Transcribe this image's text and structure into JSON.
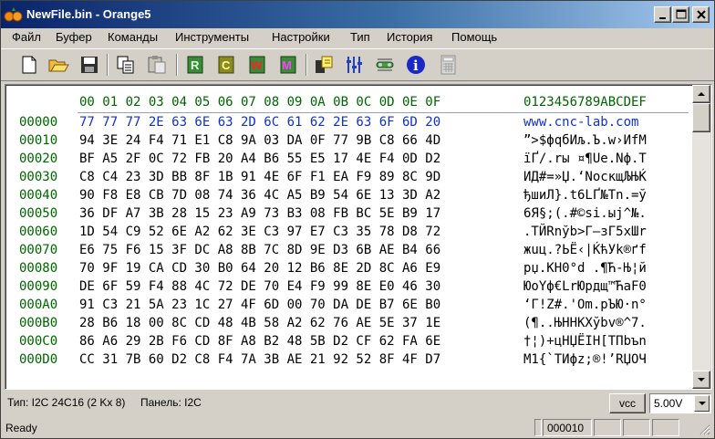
{
  "window": {
    "title": "NewFile.bin - Orange5"
  },
  "menu": [
    "Файл",
    "Буфер",
    "Команды",
    "Инструменты",
    "Настройки",
    "Тип",
    "История",
    "Помощь"
  ],
  "toolbar": {
    "read_label": "R",
    "compare_label": "C",
    "write_label": "W",
    "mode_label": "M",
    "info_label": "i",
    "colors": {
      "read": "#2a8a2a",
      "compare": "#8a8a10",
      "write": "#d01010",
      "mode": "#d010d0",
      "info": "#1010d0"
    }
  },
  "editor": {
    "header_hex": "00 01 02 03 04 05 06 07 08 09 0A 0B 0C 0D 0E 0F",
    "header_ascii": "0123456789ABCDEF",
    "rows": [
      {
        "addr": "00000",
        "hex": "77 77 77 2E 63 6E 63 2D 6C 61 62 2E 63 6F 6D 20",
        "ascii": "www.cnc-lab.com "
      },
      {
        "addr": "00010",
        "hex": "94 3E 24 F4 71 E1 C8 9A 03 DA 0F 77 9B C8 66 4D",
        "ascii": "”>$фqбИљ.Ъ.w›ИfM"
      },
      {
        "addr": "00020",
        "hex": "BF A5 2F 0C 72 FB 20 A4 B6 55 E5 17 4E F4 0D D2",
        "ascii": "їҐ/.rы ¤¶Uе.Nф.Т"
      },
      {
        "addr": "00030",
        "hex": "C8 C4 23 3D BB 8F 1B 91 4E 6F F1 EA F9 89 8C 9D",
        "ascii": "ИД#=»Џ.‘NoскщЉЊЌ"
      },
      {
        "addr": "00040",
        "hex": "90 F8 E8 CB 7D 08 74 36 4C A5 B9 54 6E 13 3D A2",
        "ascii": "ђшиЛ}.t6LҐ№Tn.=ў"
      },
      {
        "addr": "00050",
        "hex": "36 DF A7 3B 28 15 23 A9 73 B3 08 FB BC 5E B9 17",
        "ascii": "6Я§;(.#©sі.ыј^№."
      },
      {
        "addr": "00060",
        "hex": "1D 54 C9 52 6E A2 62 3E C3 97 E7 C3 35 78 D8 72",
        "ascii": ".TЙRnўb>Г—зГ5xШr"
      },
      {
        "addr": "00070",
        "hex": "E6 75 F6 15 3F DC A8 8B 7C 8D 9E D3 6B AE B4 66",
        "ascii": "жuц.?ЬЁ‹|ЌћУk®ґf"
      },
      {
        "addr": "00080",
        "hex": "70 9F 19 CA CD 30 B0 64 20 12 B6 8E 2D 8C A6 E9",
        "ascii": "pџ.КН0°d .¶Ћ-Њ¦й"
      },
      {
        "addr": "00090",
        "hex": "DE 6F 59 F4 88 4C 72 DE 70 E4 F9 99 8E E0 46 30",
        "ascii": "ЮoYф€LrЮpдщ™ЋаF0"
      },
      {
        "addr": "000A0",
        "hex": "91 C3 21 5A 23 1C 27 4F 6D 00 70 DA DE B7 6E B0",
        "ascii": "‘Г!Z#.'Om.pЪЮ·n°"
      },
      {
        "addr": "000B0",
        "hex": "28 B6 18 00 8C CD 48 4B 58 A2 62 76 AE 5E 37 1E",
        "ascii": "(¶..ЊНHKXўbv®^7."
      },
      {
        "addr": "000C0",
        "hex": "86 A6 29 2B F6 CD 8F A8 B2 48 5B D2 CF 62 FA 6E",
        "ascii": "†¦)+цНЏЁІH[ТПbъn"
      },
      {
        "addr": "000D0",
        "hex": "CC 31 7B 60 D2 C8 F4 7A 3B AE 21 92 52 8F 4F D7",
        "ascii": "М1{`ТИфz;®!’RЏOЧ"
      }
    ]
  },
  "infobar": {
    "type_text": "Тип: I2C 24C16 (2 Kx 8)",
    "panel_text": "Панель: I2C",
    "vcc_label": "vcc",
    "voltage": "5.00V"
  },
  "status": {
    "ready": "Ready",
    "address": "000010"
  }
}
